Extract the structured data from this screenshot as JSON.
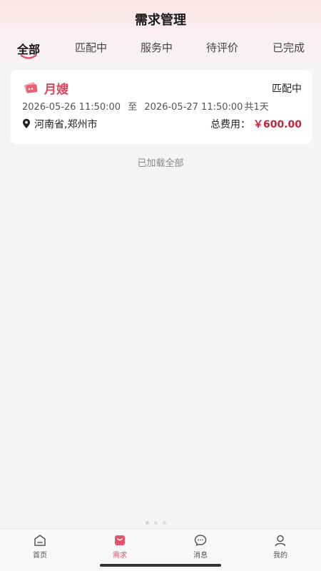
{
  "header": {
    "title": "需求管理"
  },
  "tabs": [
    {
      "label": "全部",
      "active": true
    },
    {
      "label": "匹配中",
      "active": false
    },
    {
      "label": "服务中",
      "active": false
    },
    {
      "label": "待评价",
      "active": false
    },
    {
      "label": "已完成",
      "active": false
    }
  ],
  "order": {
    "service_icon": "cards-icon",
    "service_name": "月嫂",
    "status": "匹配中",
    "start_time": "2026-05-26 11:50:00",
    "to": "至",
    "end_time": "2026-05-27 11:50:00",
    "duration": "共1天",
    "location_icon": "location-pin-icon",
    "location": "河南省,郑州市",
    "fee_label": "总费用：",
    "fee_value": "￥600.00"
  },
  "list_footer": "已加载全部",
  "bottom_nav": [
    {
      "label": "首页",
      "icon": "home-icon",
      "active": false
    },
    {
      "label": "需求",
      "icon": "demand-bag-icon",
      "active": true
    },
    {
      "label": "消息",
      "icon": "message-icon",
      "active": false
    },
    {
      "label": "我的",
      "icon": "profile-icon",
      "active": false
    }
  ],
  "colors": {
    "accent": "#d9485e",
    "price": "#c7243a",
    "background": "#f4f4f4"
  }
}
